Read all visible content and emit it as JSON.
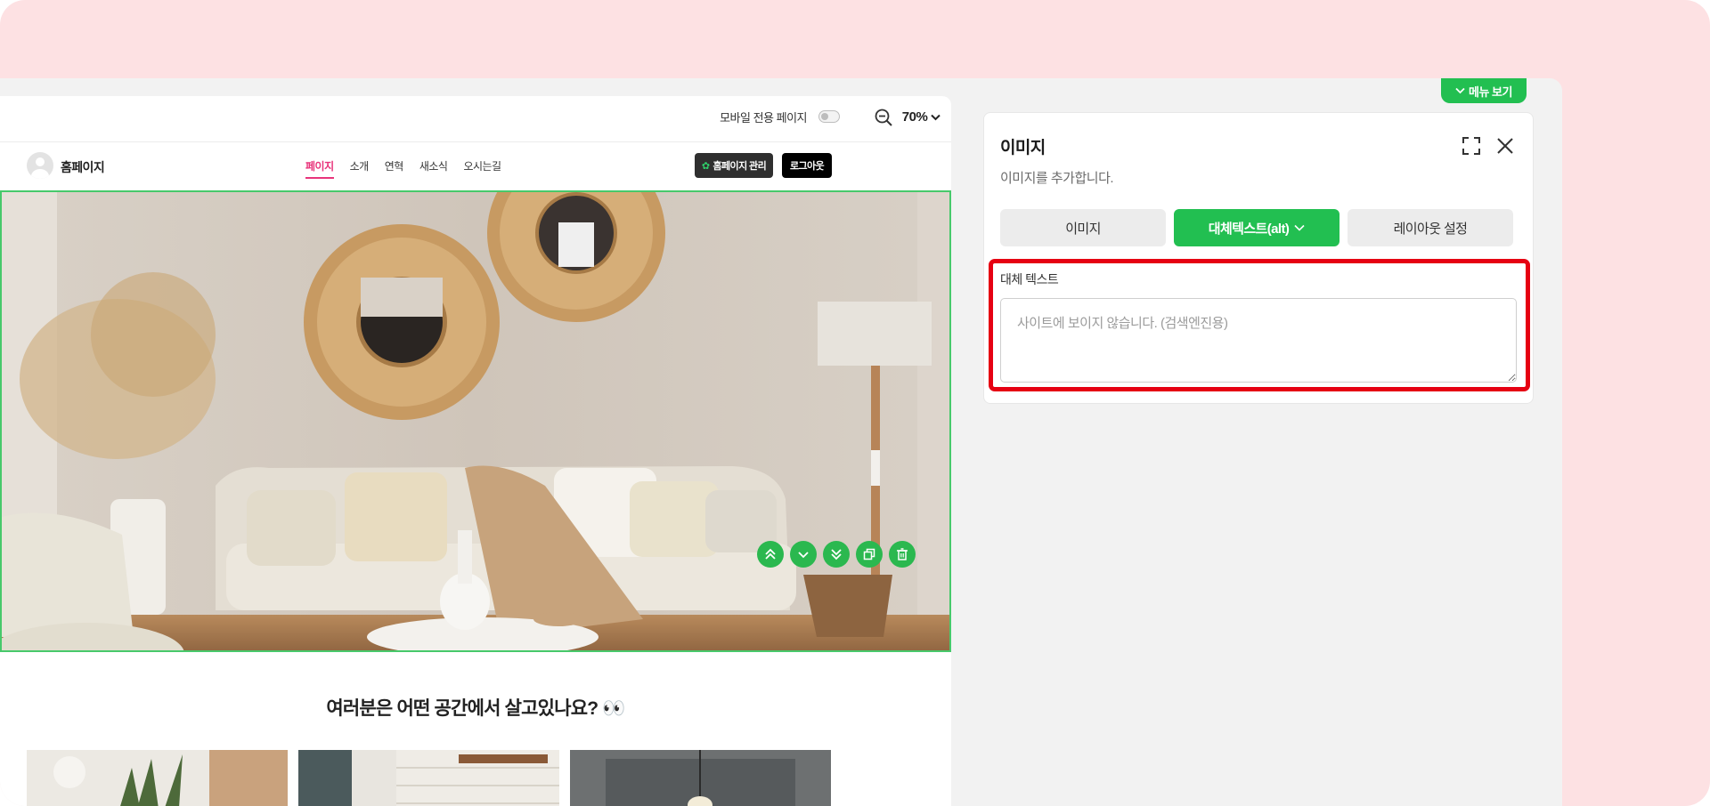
{
  "colors": {
    "accent_green": "#22bf51",
    "nav_active": "#e8347b",
    "highlight_red": "#e60012",
    "outer_bg": "#fde1e3"
  },
  "canvas": {
    "toolbar": {
      "mobile_only_label": "모바일 전용 페이지",
      "zoom_value": "70%"
    },
    "site": {
      "title": "홈페이지",
      "nav": [
        {
          "label": "페이지",
          "active": true
        },
        {
          "label": "소개",
          "active": false
        },
        {
          "label": "연혁",
          "active": false
        },
        {
          "label": "새소식",
          "active": false
        },
        {
          "label": "오시는길",
          "active": false
        }
      ],
      "manage_button": "홈페이지 관리",
      "logout_button": "로그아웃"
    },
    "block_tools": [
      "move-top-icon",
      "move-down-icon",
      "move-bottom-icon",
      "copy-icon",
      "delete-icon"
    ],
    "section_title": "여러분은 어떤 공간에서 살고있나요? 👀"
  },
  "panel": {
    "menu_toggle": "메뉴 보기",
    "title": "이미지",
    "subtitle": "이미지를 추가합니다.",
    "tabs": [
      {
        "label": "이미지",
        "active": false
      },
      {
        "label": "대체텍스트(alt)",
        "active": true
      },
      {
        "label": "레이아웃 설정",
        "active": false
      }
    ],
    "alt_field": {
      "label": "대체 텍스트",
      "value": "",
      "placeholder": "사이트에 보이지 않습니다. (검색엔진용)"
    }
  }
}
